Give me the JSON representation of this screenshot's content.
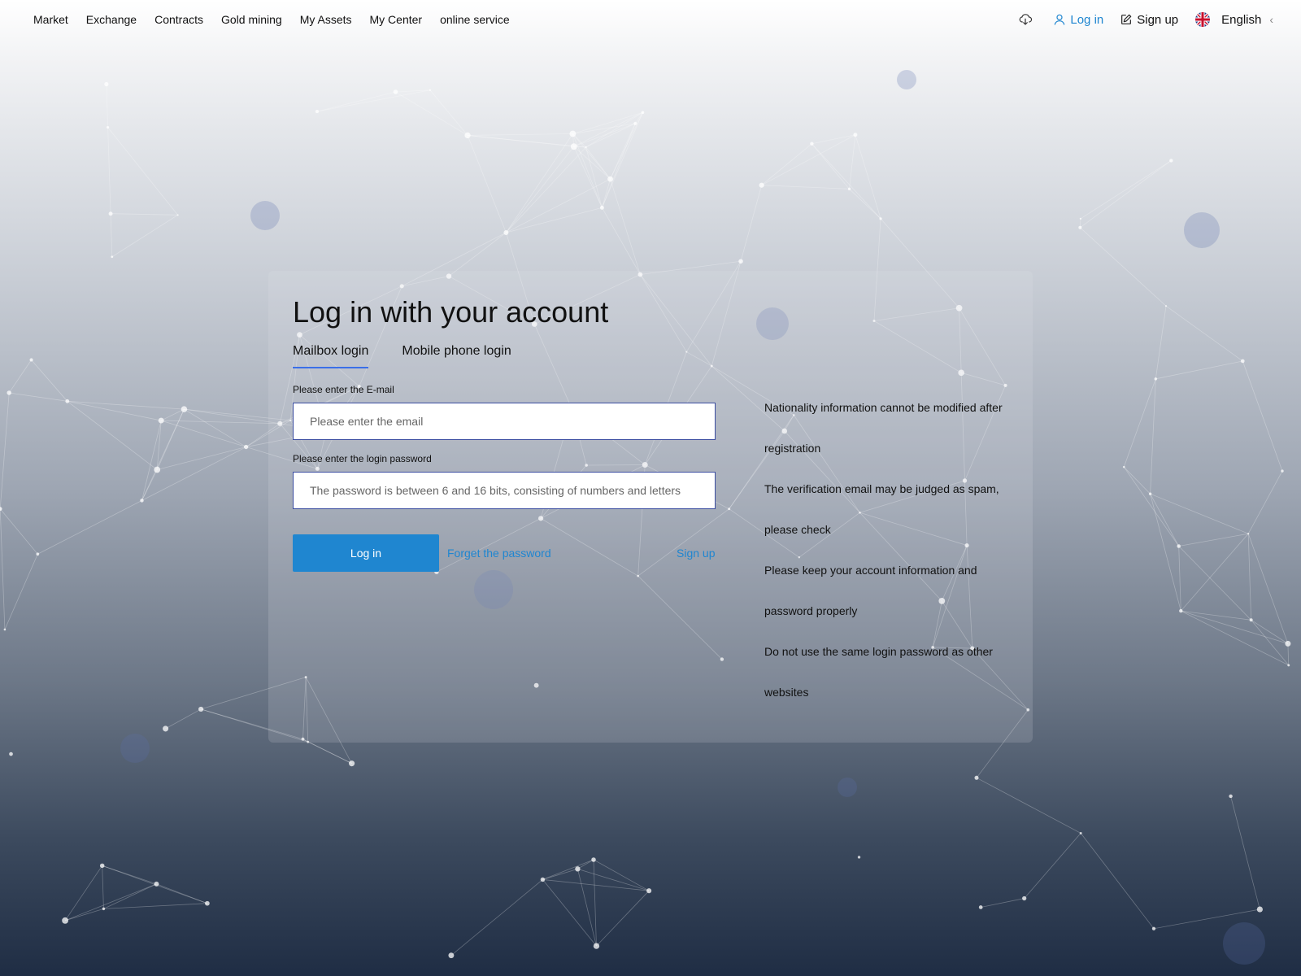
{
  "nav": {
    "items": [
      "Market",
      "Exchange",
      "Contracts",
      "Gold mining",
      "My Assets",
      "My Center",
      "online service"
    ],
    "login_label": "Log in",
    "signup_label": "Sign up",
    "language_label": "English"
  },
  "icons": {
    "download": "cloud-download-icon",
    "login": "user-icon",
    "signup": "edit-icon",
    "language": "uk-flag-icon",
    "language_arrow": "chevron-left-icon"
  },
  "colors": {
    "accent": "#1f86d0",
    "tab_underline": "#3b6fe8"
  },
  "login": {
    "title": "Log in with your account",
    "tabs": [
      {
        "label": "Mailbox login",
        "active": true
      },
      {
        "label": "Mobile phone login",
        "active": false
      }
    ],
    "email_label": "Please enter the E-mail",
    "email_placeholder": "Please enter the email",
    "email_value": "",
    "password_label": "Please enter the login password",
    "password_placeholder": "The password is between 6 and 16 bits, consisting of numbers and letters",
    "password_value": "",
    "submit_label": "Log in",
    "forget_label": "Forget the password",
    "signup_label": "Sign up"
  },
  "tips": [
    "Nationality information cannot be modified after registration",
    "The verification email may be judged as spam, please check",
    "Please keep your account information and password properly",
    "Do not use the same login password as other websites"
  ]
}
